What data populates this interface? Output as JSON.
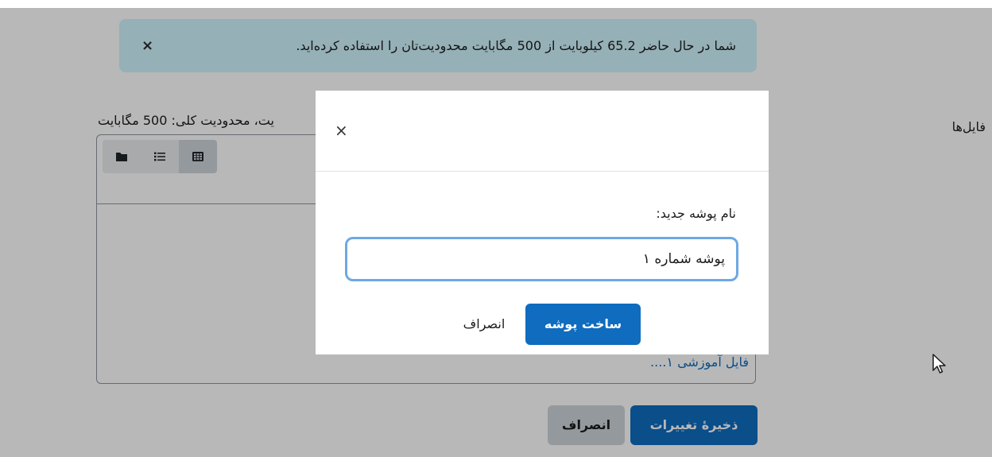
{
  "alert": {
    "text": "شما در حال حاضر 65.2 کیلوبایت از 500 مگابایت محدودیت‌تان را استفاده کرده‌اید.",
    "close": "×"
  },
  "form": {
    "files_label": "فایل‌ها",
    "limits_text": "یت، محدودیت کلی: 500 مگابایت",
    "file_link": "فایل آموزشی ۱....",
    "save_label": "ذخیرهٔ تغییرات",
    "cancel_label": "انصراف"
  },
  "view_buttons": [
    "folder-view-icon",
    "list-view-icon",
    "grid-view-icon"
  ],
  "modal": {
    "close": "×",
    "label": "نام پوشه جدید:",
    "input_value": "پوشه شماره ۱",
    "create_label": "ساخت پوشه",
    "cancel_label": "انصراف"
  },
  "colors": {
    "primary": "#0f6cbf",
    "alert_bg": "#cff4fc",
    "input_focus": "#6ea8e3"
  }
}
